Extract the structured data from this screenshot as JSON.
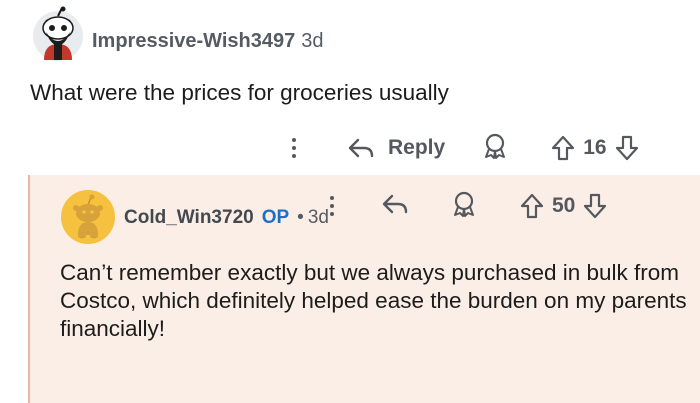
{
  "top_comment": {
    "username": "Impressive-Wish3497",
    "age": "3d",
    "text": "What were the prices for groceries usually",
    "actions": {
      "reply_label": "Reply",
      "vote_count": "16"
    }
  },
  "reply_comment": {
    "username": "Cold_Win3720",
    "op_badge": "OP",
    "separator": "•",
    "age": "3d",
    "text": "Can’t remember exactly but we always purchased in bulk from Costco, which definitely helped ease the burden on my parents financially!",
    "actions": {
      "vote_count": "50"
    }
  },
  "colors": {
    "reply_background": "#fbeee6",
    "reply_border": "#e7b8a3",
    "op_blue": "#1f6fc5",
    "icon_gray": "#55595e"
  },
  "icons": [
    "avatar-snoo-dark",
    "more-vertical-icon",
    "reply-arrow-icon",
    "award-icon",
    "upvote-icon",
    "downvote-icon",
    "avatar-snoo-yellow"
  ]
}
